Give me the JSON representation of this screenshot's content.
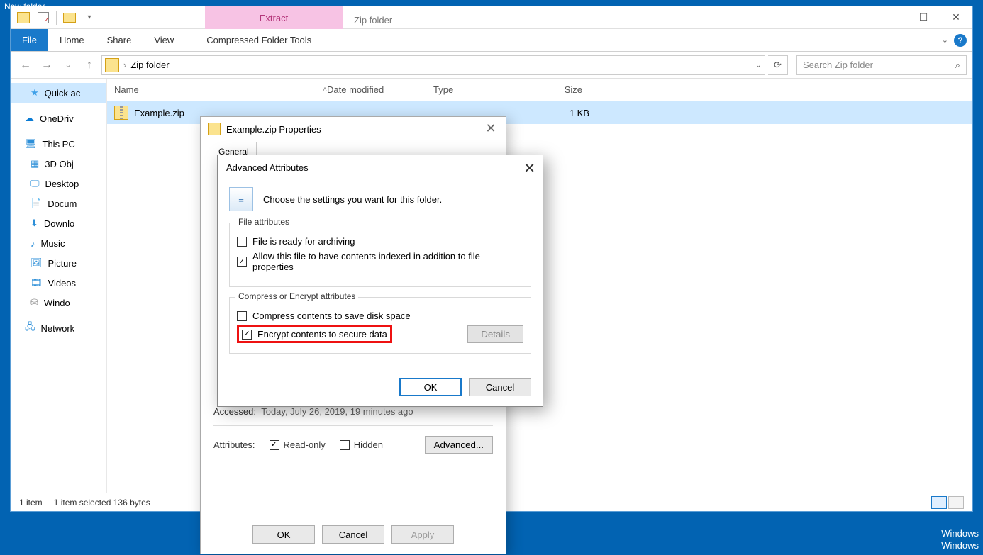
{
  "desktop": {
    "label": "New folder"
  },
  "explorer": {
    "context_tab": "Extract",
    "context_tools": "Compressed Folder Tools",
    "title_tab": "Zip folder",
    "tabs": {
      "file": "File",
      "home": "Home",
      "share": "Share",
      "view": "View"
    },
    "breadcrumb": "Zip folder",
    "search_placeholder": "Search Zip folder",
    "columns": {
      "name": "Name",
      "date": "Date modified",
      "type": "Type",
      "size": "Size"
    },
    "nav": {
      "quick": "Quick ac",
      "onedrive": "OneDriv",
      "thispc": "This PC",
      "objs": "3D Obj",
      "desktop": "Desktop",
      "docs": "Docum",
      "downloads": "Downlo",
      "music": "Music",
      "pictures": "Picture",
      "videos": "Videos",
      "windows": "Windo",
      "network": "Network"
    },
    "file_row": {
      "name": "Example.zip",
      "size": "1 KB"
    },
    "status": {
      "items": "1 item",
      "selected": "1 item selected  136 bytes"
    }
  },
  "props": {
    "title": "Example.zip Properties",
    "tab_general": "General",
    "accessed_label": "Accessed:",
    "accessed_val": "Today, July 26, 2019, 19 minutes ago",
    "attributes_label": "Attributes:",
    "readonly": "Read-only",
    "hidden": "Hidden",
    "advanced_btn": "Advanced...",
    "ok": "OK",
    "cancel": "Cancel",
    "apply": "Apply"
  },
  "adv": {
    "title": "Advanced Attributes",
    "instruction": "Choose the settings you want for this folder.",
    "group1": "File attributes",
    "chk_archive": "File is ready for archiving",
    "chk_index": "Allow this file to have contents indexed in addition to file properties",
    "group2": "Compress or Encrypt attributes",
    "chk_compress": "Compress contents to save disk space",
    "chk_encrypt": "Encrypt contents to secure data",
    "details": "Details",
    "ok": "OK",
    "cancel": "Cancel"
  },
  "watermark": {
    "l1": "Windows",
    "l2": "Windows"
  }
}
